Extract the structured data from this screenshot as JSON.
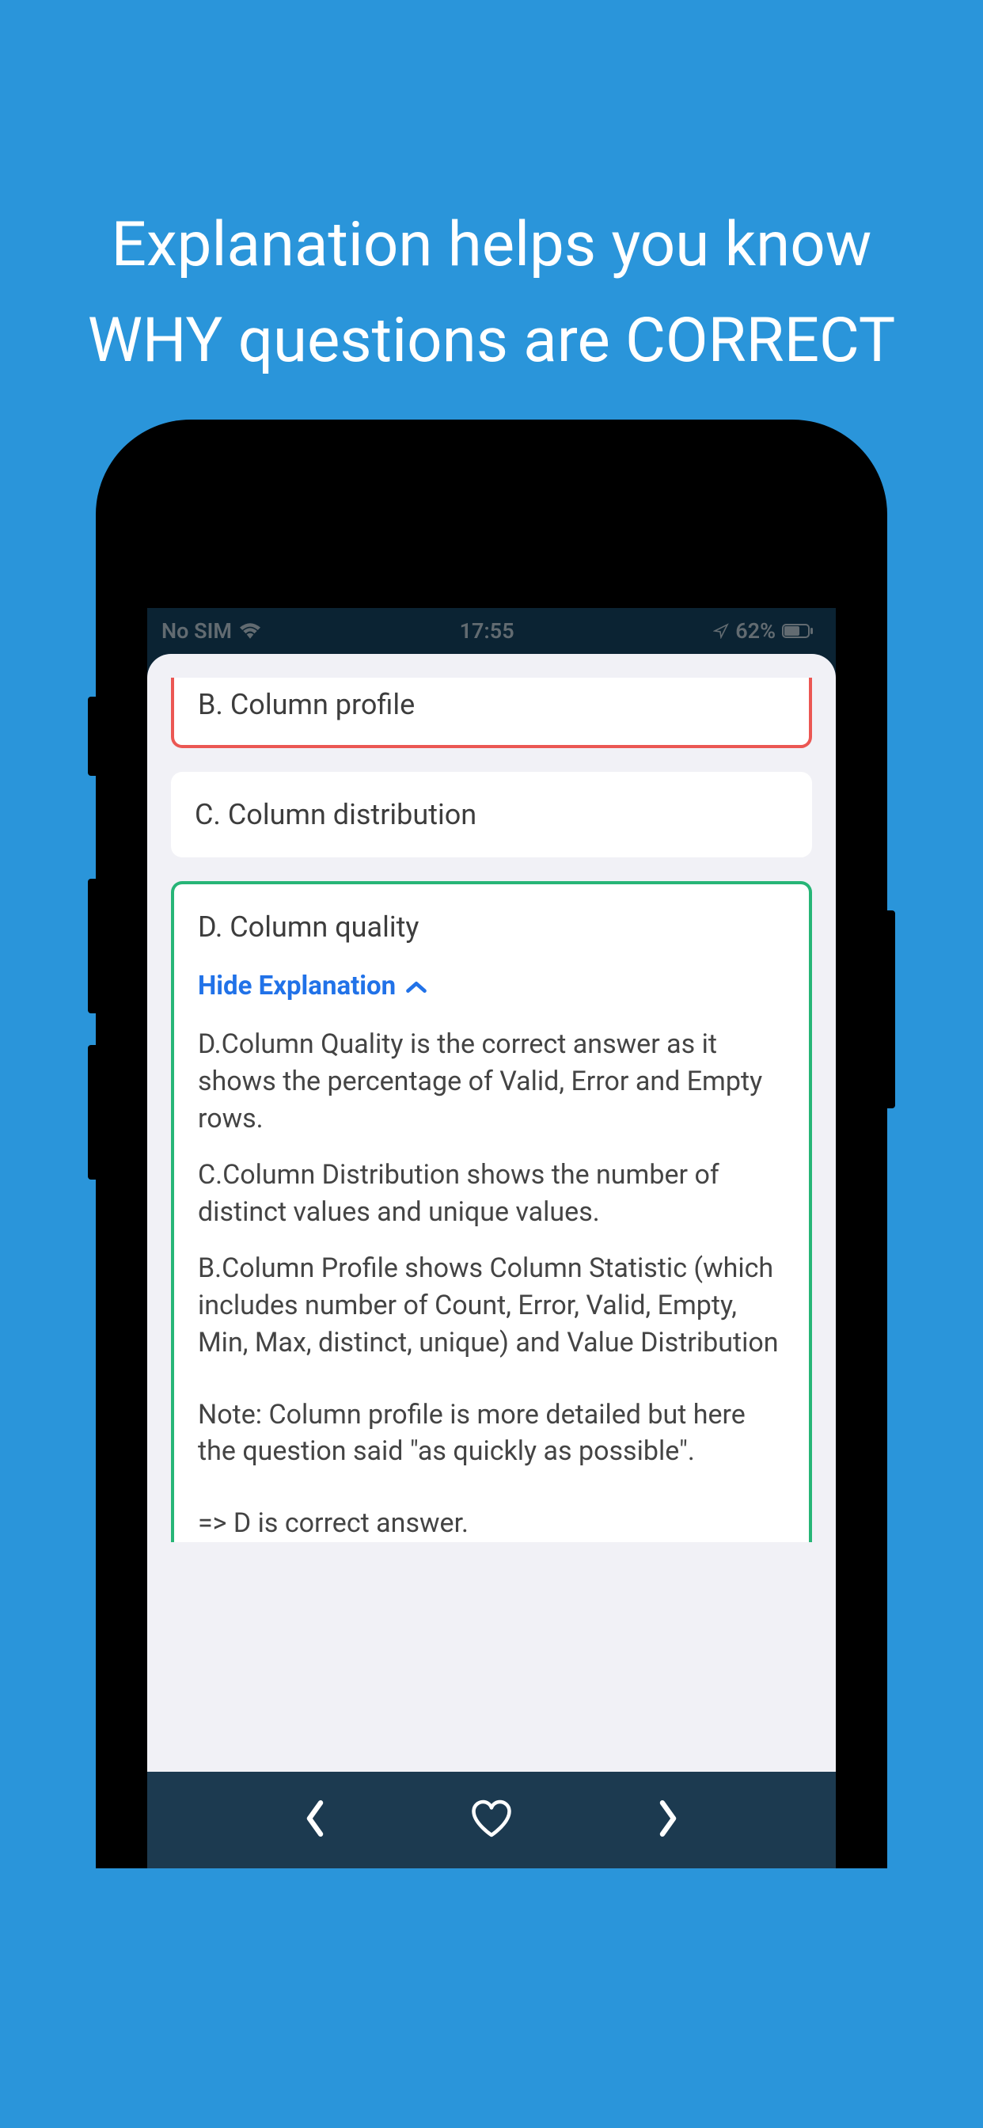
{
  "promo": {
    "headline": "Explanation helps you know WHY questions are CORRECT"
  },
  "status": {
    "carrier": "No SIM",
    "time": "17:55",
    "battery": "62%"
  },
  "options": {
    "b": "B. Column profile",
    "c": "C. Column distribution",
    "d": "D. Column quality"
  },
  "toggle": {
    "hide_label": "Hide Explanation"
  },
  "explanation": {
    "p1": "D.Column Quality is the correct answer as it shows the percentage of Valid, Error and Empty rows.",
    "p2": "C.Column Distribution shows the number of distinct values and unique values.",
    "p3": "B.Column Profile shows Column Statistic (which includes number of Count, Error, Valid, Empty, Min, Max, distinct, unique) and Value Distribution",
    "p4": "Note: Column profile is more detailed but here the question said \"as quickly as possible\".",
    "p5": "=> D is correct answer."
  },
  "icons": {
    "wifi": "wifi-icon",
    "location": "location-icon",
    "battery": "battery-icon",
    "chevron_up": "chevron-up-icon",
    "chevron_left": "chevron-left-icon",
    "chevron_right": "chevron-right-icon",
    "heart": "heart-icon"
  }
}
